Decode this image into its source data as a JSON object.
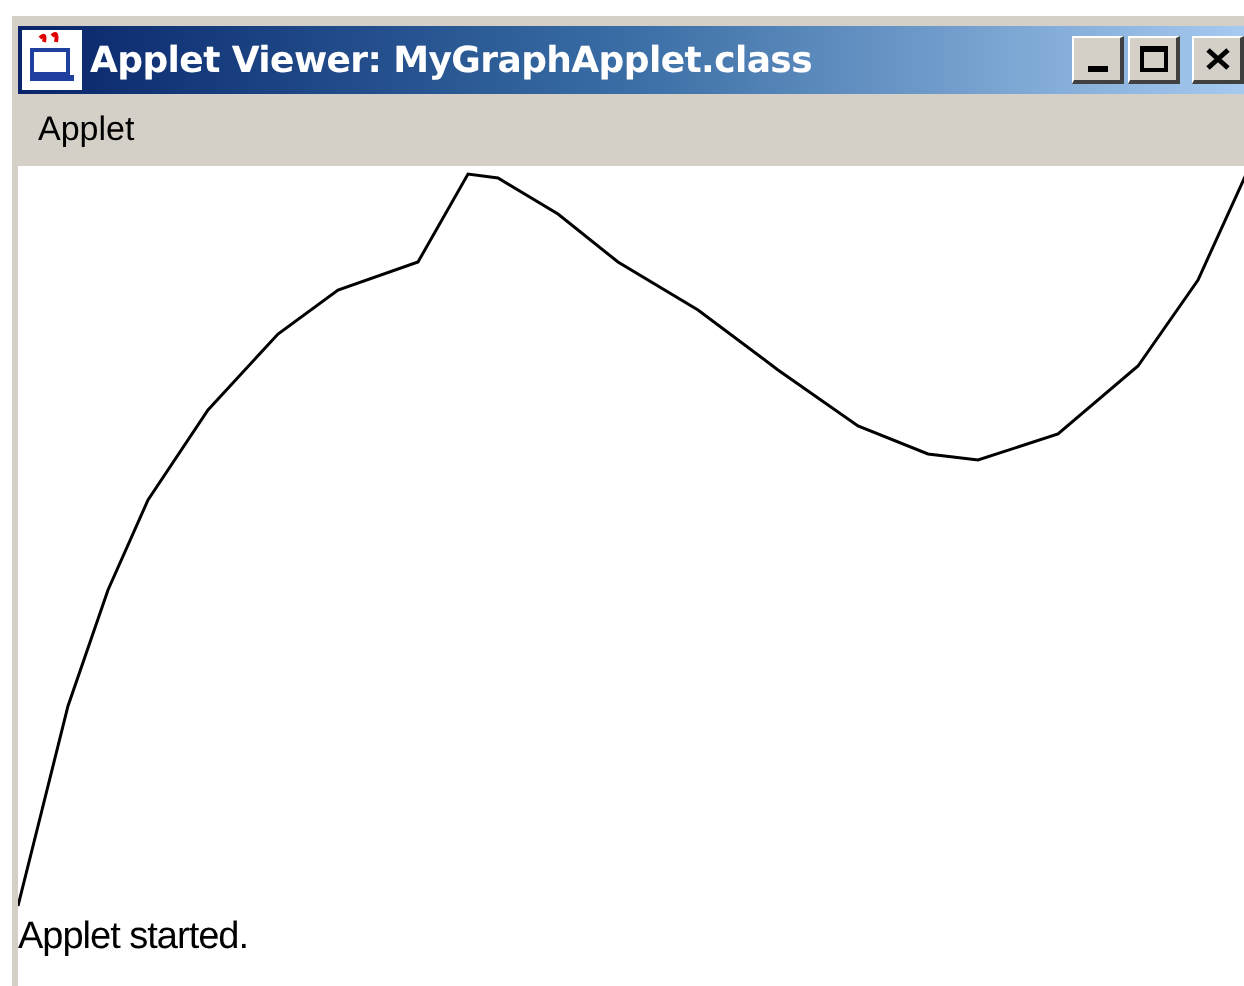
{
  "window": {
    "title": "Applet Viewer: MyGraphApplet.class"
  },
  "menu": [
    "Applet"
  ],
  "status_bar": "Applet started."
}
